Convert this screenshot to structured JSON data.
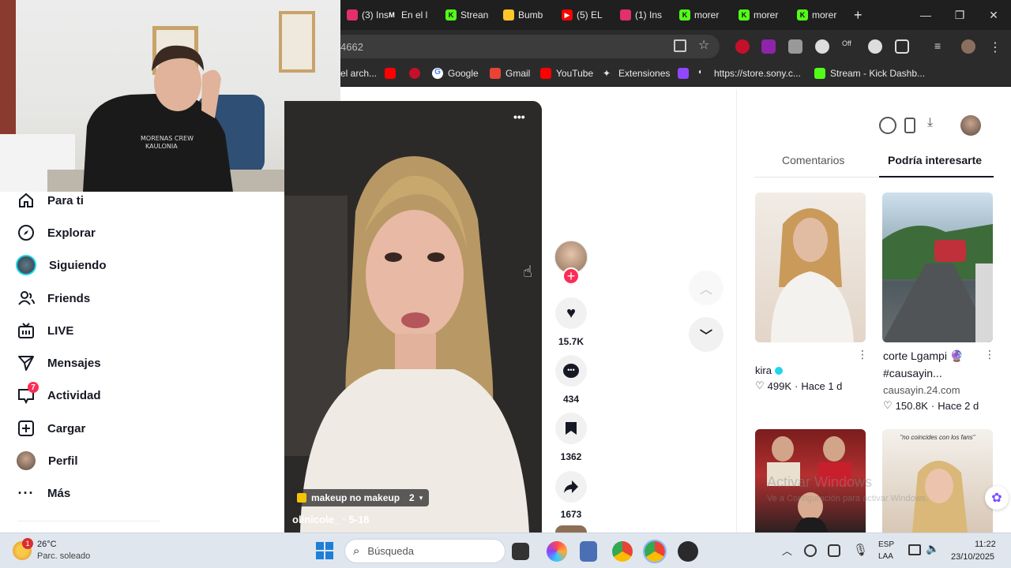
{
  "browser": {
    "tabs": [
      {
        "label": "(3) Ins",
        "icon": "instagram-icon",
        "color": "#e1306c"
      },
      {
        "label": "En el l",
        "icon": "mim-icon",
        "color": "#ffffff"
      },
      {
        "label": "Strean",
        "icon": "kick-icon",
        "color": "#53fc18"
      },
      {
        "label": "Bumb",
        "icon": "bumble-icon",
        "color": "#ffc629"
      },
      {
        "label": "(5) EL",
        "icon": "youtube-icon",
        "color": "#ff0000"
      },
      {
        "label": "(1) Ins",
        "icon": "instagram-icon",
        "color": "#e1306c"
      },
      {
        "label": "morer",
        "icon": "kick-icon",
        "color": "#53fc18"
      },
      {
        "label": "morer",
        "icon": "kick-icon",
        "color": "#53fc18"
      },
      {
        "label": "morer",
        "icon": "kick-icon",
        "color": "#53fc18"
      }
    ],
    "new_tab": "+",
    "minimize": "—",
    "maximize": "❐",
    "close": "✕",
    "url": "4662",
    "bookmarks": [
      {
        "label": "el arch...",
        "icon": "folder-icon",
        "color": "#9aa0a6"
      },
      {
        "label": "",
        "icon": "youtube-icon",
        "color": "#ff0000"
      },
      {
        "label": "",
        "icon": "red-icon",
        "color": "#c4102a"
      },
      {
        "label": "Google",
        "icon": "google-icon",
        "color": "#4285f4"
      },
      {
        "label": "Gmail",
        "icon": "gmail-icon",
        "color": "#ea4335"
      },
      {
        "label": "YouTube",
        "icon": "youtube-icon",
        "color": "#ff0000"
      },
      {
        "label": "Extensiones",
        "icon": "puzzle-icon",
        "color": "#e8e8e8"
      },
      {
        "label": "",
        "icon": "twitch-icon",
        "color": "#9146ff"
      },
      {
        "label": "https://store.sony.c...",
        "icon": "playstation-icon",
        "color": "#e8e8e8"
      },
      {
        "label": "Stream - Kick Dashb...",
        "icon": "kick-icon",
        "color": "#53fc18"
      }
    ]
  },
  "sidebar": {
    "items": [
      {
        "label": "Para ti",
        "icon": "home-icon"
      },
      {
        "label": "Explorar",
        "icon": "compass-icon"
      },
      {
        "label": "Siguiendo",
        "icon": "avatar-icon"
      },
      {
        "label": "Friends",
        "icon": "friends-icon"
      },
      {
        "label": "LIVE",
        "icon": "live-icon"
      },
      {
        "label": "Mensajes",
        "icon": "send-icon"
      },
      {
        "label": "Actividad",
        "icon": "inbox-icon",
        "badge": "7"
      },
      {
        "label": "Cargar",
        "icon": "upload-icon"
      },
      {
        "label": "Perfil",
        "icon": "profile-avatar-icon"
      },
      {
        "label": "Más",
        "icon": "more-icon"
      }
    ]
  },
  "video": {
    "menu": "•••",
    "playlist_label": "makeup no makeup",
    "playlist_count": "2",
    "author_line": "olinicole_ · 5-18",
    "likes": "15.7K",
    "comments": "434",
    "saves": "1362",
    "shares": "1673"
  },
  "right_panel": {
    "tabs": [
      "Comentarios",
      "Podría interesarte"
    ],
    "active_tab": 1,
    "cards": [
      {
        "title": "",
        "author": "kira",
        "verified": true,
        "likes": "499K",
        "time": "Hace 1 d"
      },
      {
        "title": "corte Lgampi 🔮 #causayin...",
        "author": "causayin.24.com",
        "verified": false,
        "likes": "150.8K",
        "time": "Hace 2 d"
      }
    ],
    "thumb_bottom_right_text": "\"no coincides con los fans\"",
    "watermark_line1": "Activar Windows",
    "watermark_line2": "Ve a Configuración para activar Windows."
  },
  "taskbar": {
    "weather_temp": "26°C",
    "weather_desc": "Parc. soleado",
    "weather_badge": "1",
    "search_placeholder": "Búsqueda",
    "lang_line1": "ESP",
    "lang_line2": "LAA",
    "time": "11:22",
    "date": "23/10/2025"
  },
  "colors": {
    "tiktok_pink": "#fe2c55",
    "verified_blue": "#20d5ec",
    "chrome_dark": "#1f1f1f"
  }
}
